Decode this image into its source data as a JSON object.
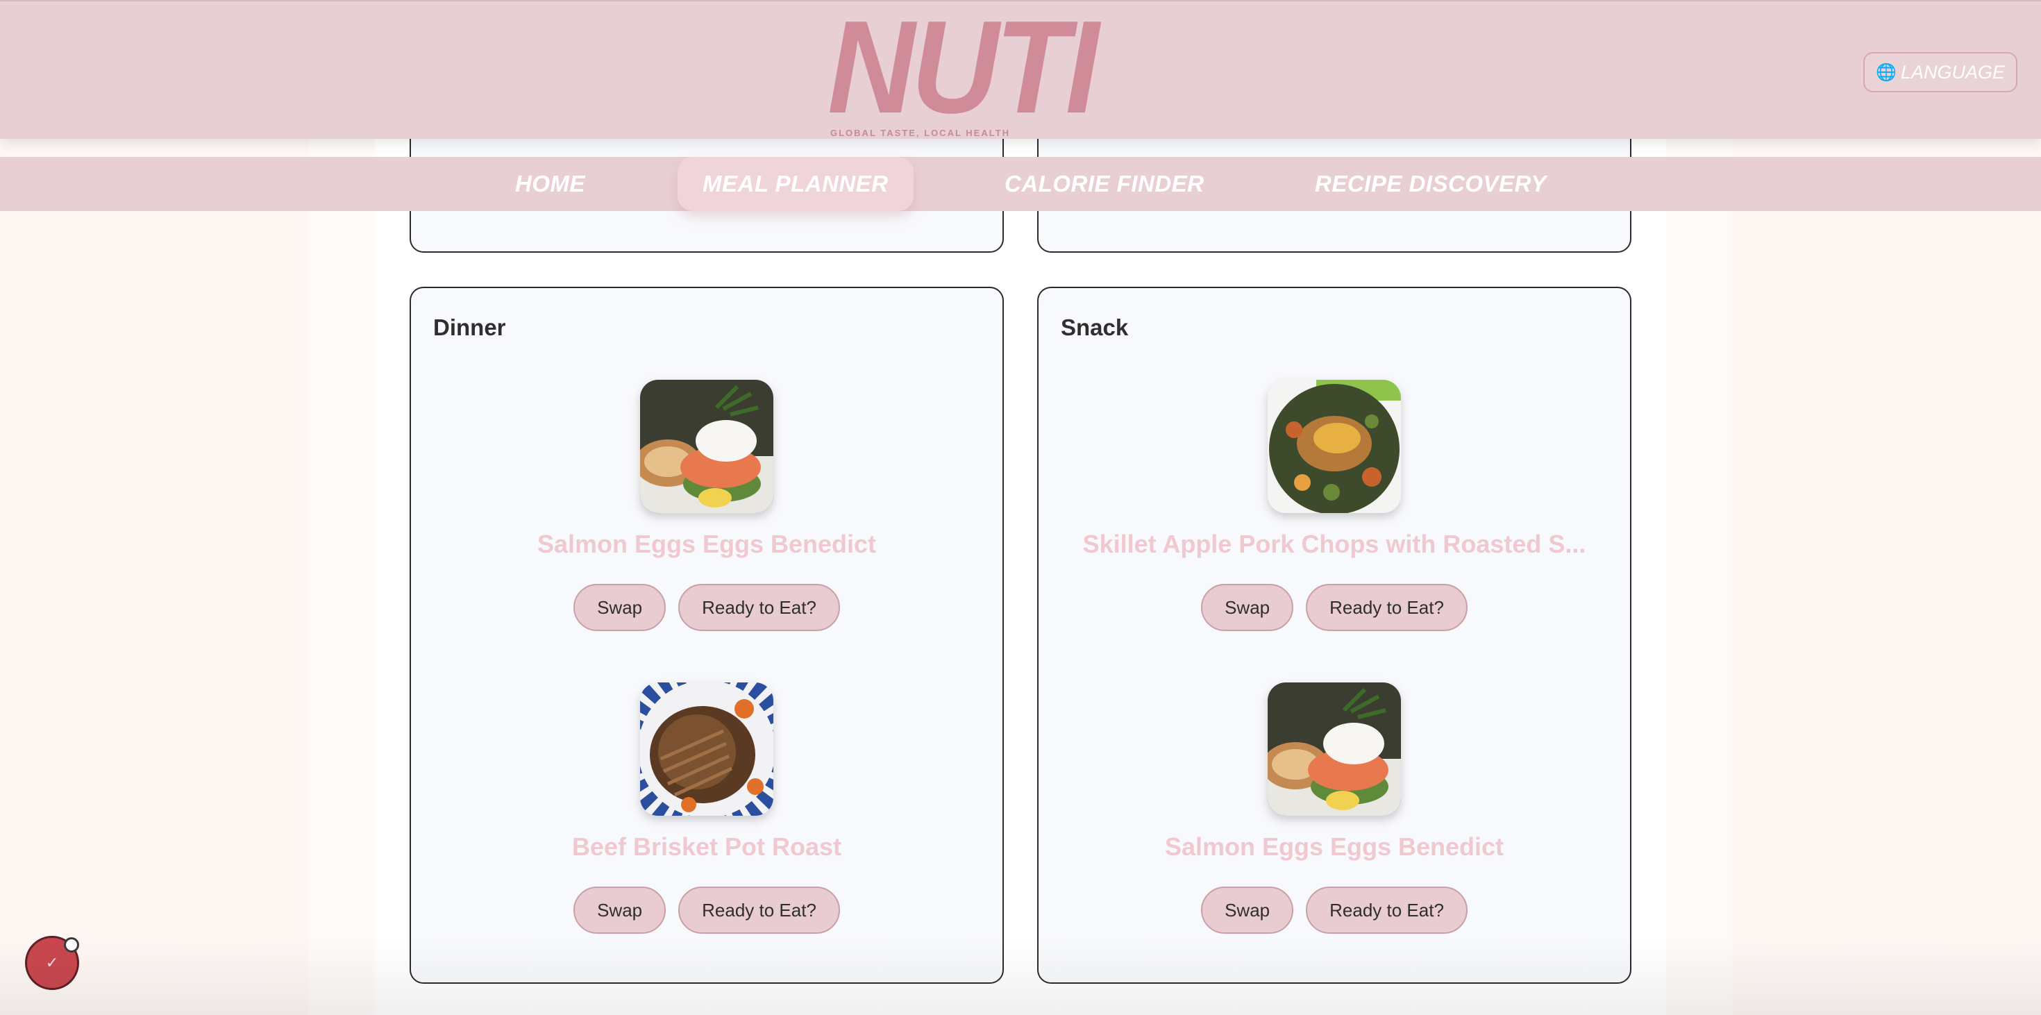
{
  "header": {
    "logo": "NUTI",
    "tagline": "GLOBAL TASTE, LOCAL HEALTH",
    "language_icon": "globe-icon",
    "language_label": "LANGUAGE"
  },
  "nav": {
    "items": [
      {
        "label": "HOME",
        "active": false
      },
      {
        "label": "MEAL PLANNER",
        "active": true
      },
      {
        "label": "CALORIE FINDER",
        "active": false
      },
      {
        "label": "RECIPE DISCOVERY",
        "active": false
      }
    ]
  },
  "meals": [
    {
      "title": "Dinner",
      "recipes": [
        {
          "name": "Salmon Eggs Eggs Benedict",
          "image": "salmon-eggs-benedict",
          "swap_label": "Swap",
          "ready_label": "Ready to Eat?"
        },
        {
          "name": "Beef Brisket Pot Roast",
          "image": "beef-brisket-pot-roast",
          "swap_label": "Swap",
          "ready_label": "Ready to Eat?"
        }
      ]
    },
    {
      "title": "Snack",
      "recipes": [
        {
          "name": "Skillet Apple Pork Chops with Roasted S...",
          "image": "skillet-apple-pork-chops",
          "swap_label": "Swap",
          "ready_label": "Ready to Eat?"
        },
        {
          "name": "Salmon Eggs Eggs Benedict",
          "image": "salmon-eggs-benedict",
          "swap_label": "Swap",
          "ready_label": "Ready to Eat?"
        }
      ]
    }
  ],
  "fab": {
    "icon": "assistant-icon"
  },
  "colors": {
    "header_bg": "#e8cfd4",
    "logo": "#d08b98",
    "recipe_name": "#efc9cf",
    "button_bg": "#e8ccd1",
    "card_bg": "#f8f9fc"
  }
}
